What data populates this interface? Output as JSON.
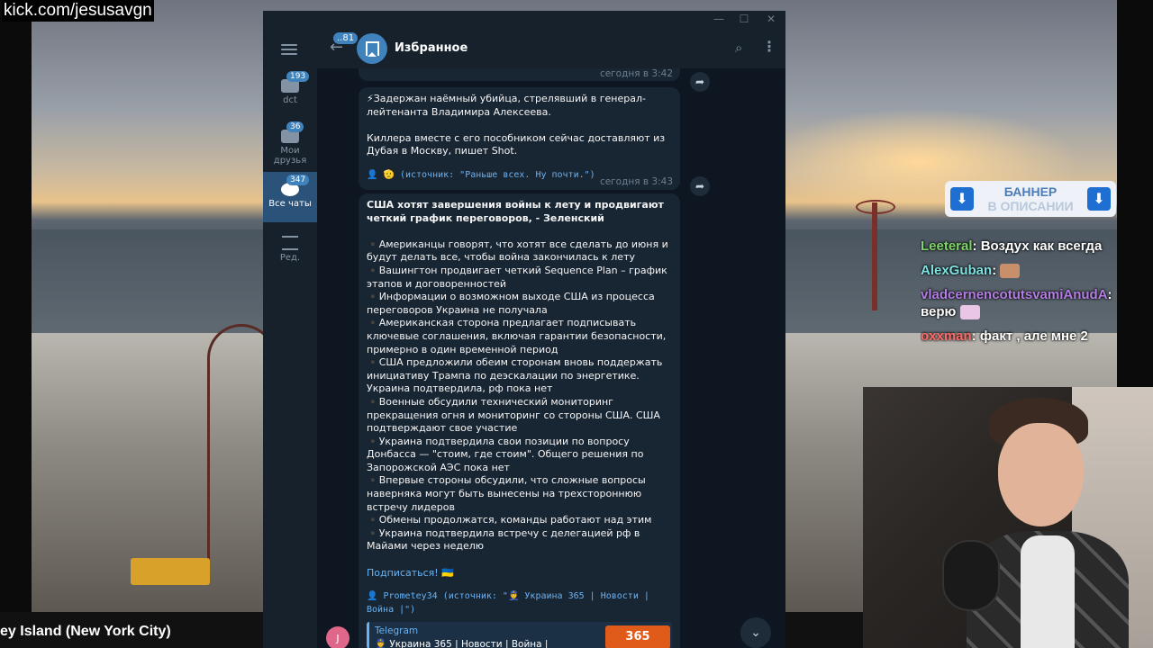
{
  "stream": {
    "site_url": "kick.com/jesusavgn",
    "location": "ey Island (New York City)",
    "banner": {
      "line1": "БАННЕР",
      "line2": "В ОПИСАНИИ"
    }
  },
  "chat_messages": [
    {
      "user": "Leeteral",
      "user_color": "#7fd46a",
      "text": ": Воздух как всегда",
      "emote": false
    },
    {
      "user": "AlexGuban",
      "user_color": "#7ee0e0",
      "text": ":",
      "emote": true
    },
    {
      "user": "vladcernencotutsvamiAnudA",
      "user_color": "#b47de4",
      "text": ":",
      "emote": false
    },
    {
      "user": "",
      "user_color": "#ffffff",
      "text": "верю",
      "emote": true
    },
    {
      "user": "oxxman",
      "user_color": "#ff6b6b",
      "text": ": факт , але мне 2",
      "emote": false
    }
  ],
  "telegram": {
    "window_controls": [
      "—",
      "☐",
      "✕"
    ],
    "sidebar": {
      "folders": [
        {
          "label": "dct",
          "badge": "193",
          "active": false
        },
        {
          "label": "Мои друзья",
          "badge": "36",
          "active": false
        },
        {
          "label": "Все чаты",
          "badge": "347",
          "active": true
        },
        {
          "label": "Ред.",
          "badge": "",
          "active": false
        }
      ]
    },
    "header": {
      "unread": "..81",
      "title": "Избранное"
    },
    "messages": {
      "m0_time": "сегодня в 3:42",
      "m1_text1": "⚡Задержан наёмный убийца, стрелявший в генерал-лейтенанта Владимира Алексеева.",
      "m1_text2": "Киллера вместе с его пособником сейчас доставляют из Дубая в Москву, пишет Shot.",
      "m1_source": "👤 🫡 (источник: \"Раньше всех. Ну почти.\")",
      "m1_time": "сегодня в 3:43",
      "m2_title": "США хотят завершения войны к лету и продвигают четкий график переговоров, - Зеленский",
      "m2_items": [
        "▪️Американцы говорят, что хотят все сделать до июня и будут делать все, чтобы война закончилась к лету",
        "▪️Вашингтон продвигает четкий Sequence Plan – график этапов и договоренностей",
        "▪️Информации о возможном выходе США из процесса переговоров Украина не получала",
        "▪️Американская сторона предлагает подписывать ключевые соглашения, включая гарантии безопасности, примерно в один временной период",
        "▪️США предложили обеим сторонам вновь поддержать инициативу Трампа по деэскалации по энергетике. Украина подтвердила, рф пока нет",
        "▪️Военные обсудили технический мониторинг прекращения огня и мониторинг со стороны США. США подтверждают свое участие",
        "▪️Украина подтвердила свои позиции по вопросу Донбасса — \"стоим, где стоим\". Общего решения по Запорожской АЭС пока нет",
        "▪️Впервые стороны обсудили, что сложные вопросы наверняка могут быть вынесены на трехстороннюю встречу лидеров",
        "▪️Обмены продолжатся, команды работают над этим",
        "▪️Украина подтвердила встречу с делегацией рф в Майами через неделю"
      ],
      "m2_subscribe": "Подписаться! 🇺🇦",
      "m2_source": "👤 Prometey34 (источник: \"👮 Украина 365 | Новости | Война |\")",
      "preview_title": "Telegram",
      "preview_desc": "👮 Украина 365 | Новости | Война |",
      "preview_thumb": "365",
      "user_avatar_letter": "J"
    }
  }
}
